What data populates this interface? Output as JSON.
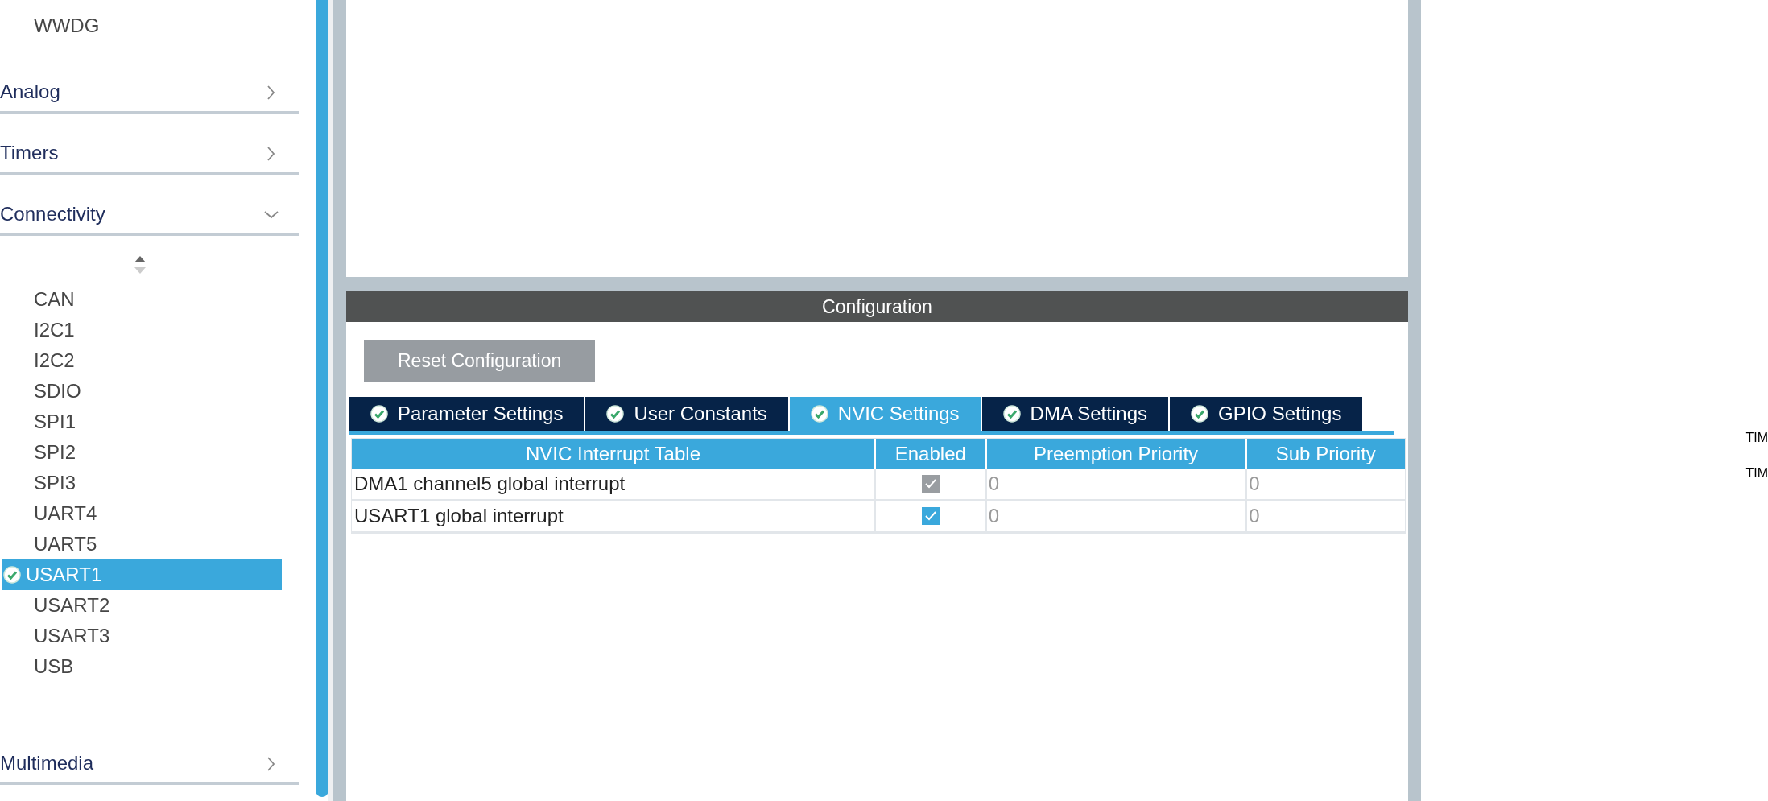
{
  "sidebar": {
    "top_items": [
      {
        "label": "WWDG",
        "selected": false
      }
    ],
    "categories": [
      {
        "label": "Analog",
        "expanded": false
      },
      {
        "label": "Timers",
        "expanded": false
      },
      {
        "label": "Connectivity",
        "expanded": true,
        "children": [
          {
            "label": "CAN",
            "selected": false,
            "configured": false
          },
          {
            "label": "I2C1",
            "selected": false,
            "configured": false
          },
          {
            "label": "I2C2",
            "selected": false,
            "configured": false
          },
          {
            "label": "SDIO",
            "selected": false,
            "configured": false
          },
          {
            "label": "SPI1",
            "selected": false,
            "configured": false
          },
          {
            "label": "SPI2",
            "selected": false,
            "configured": false
          },
          {
            "label": "SPI3",
            "selected": false,
            "configured": false
          },
          {
            "label": "UART4",
            "selected": false,
            "configured": false
          },
          {
            "label": "UART5",
            "selected": false,
            "configured": false
          },
          {
            "label": "USART1",
            "selected": true,
            "configured": true
          },
          {
            "label": "USART2",
            "selected": false,
            "configured": false
          },
          {
            "label": "USART3",
            "selected": false,
            "configured": false
          },
          {
            "label": "USB",
            "selected": false,
            "configured": false
          }
        ]
      },
      {
        "label": "Multimedia",
        "expanded": false
      }
    ]
  },
  "configuration": {
    "title": "Configuration",
    "reset_button": "Reset Configuration",
    "tabs": [
      {
        "label": "Parameter Settings",
        "selected": false,
        "configured": true
      },
      {
        "label": "User Constants",
        "selected": false,
        "configured": true
      },
      {
        "label": "NVIC Settings",
        "selected": true,
        "configured": true
      },
      {
        "label": "DMA Settings",
        "selected": false,
        "configured": true
      },
      {
        "label": "GPIO Settings",
        "selected": false,
        "configured": true
      }
    ],
    "table": {
      "columns": [
        "NVIC Interrupt Table",
        "Enabled",
        "Preemption Priority",
        "Sub Priority"
      ],
      "rows": [
        {
          "name": "DMA1 channel5 global interrupt",
          "checked": true,
          "disabled": true,
          "preemption": "0",
          "sub": "0"
        },
        {
          "name": "USART1 global interrupt",
          "checked": true,
          "disabled": false,
          "preemption": "0",
          "sub": "0"
        }
      ]
    }
  },
  "right_labels": [
    "TIM",
    "TIM"
  ]
}
